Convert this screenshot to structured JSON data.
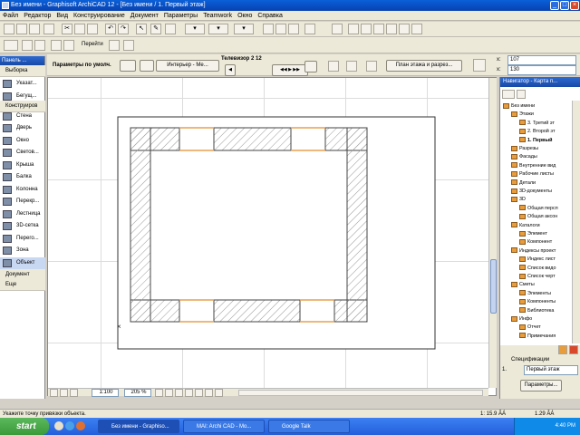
{
  "window": {
    "title": "Без имени - Graphisoft ArchiCAD 12 - [Без имени / 1. Первый этаж]"
  },
  "menu": [
    "Файл",
    "Редактор",
    "Вид",
    "Конструирование",
    "Документ",
    "Параметры",
    "Teamwork",
    "Окно",
    "Справка"
  ],
  "toolbar2": {
    "goto_label": "Перейти"
  },
  "infobox": {
    "default_params": "Параметры по умолч.",
    "interior_view": "Интерьер - Ме...",
    "object_name": "Телевизор 2 12",
    "plan_section": "План этажа и разрез...",
    "coord_x_label": "x:",
    "coord_x": "107",
    "coord_y_label": "x:",
    "coord_y": "130"
  },
  "toolbox": {
    "header": "Панель ...",
    "selection_group": "Выборка",
    "items": [
      "Указат...",
      "Бегущ...",
      "Конструиров",
      "Стена",
      "Дверь",
      "Окно",
      "Светов...",
      "Крыша",
      "Балка",
      "Колонна",
      "Перекр...",
      "Лестница",
      "3D-сетка",
      "Перего...",
      "Зона",
      "Объект",
      "Документ",
      "Еще"
    ]
  },
  "navigator": {
    "header": "Навигатор - Карта п...",
    "tree": [
      {
        "label": "Без имени",
        "level": 0
      },
      {
        "label": "Этажи",
        "level": 1
      },
      {
        "label": "3. Третий эт",
        "level": 2
      },
      {
        "label": "2. Второй эт",
        "level": 2
      },
      {
        "label": "1. Первый",
        "level": 2
      },
      {
        "label": "Разрезы",
        "level": 1
      },
      {
        "label": "Фасады",
        "level": 1
      },
      {
        "label": "Внутренние вид",
        "level": 1
      },
      {
        "label": "Рабочие листы",
        "level": 1
      },
      {
        "label": "Детали",
        "level": 1
      },
      {
        "label": "3D-документы",
        "level": 1
      },
      {
        "label": "3D",
        "level": 1
      },
      {
        "label": "Общая персп",
        "level": 2
      },
      {
        "label": "Общая аксон",
        "level": 2
      },
      {
        "label": "Каталоги",
        "level": 1
      },
      {
        "label": "Элемент",
        "level": 2
      },
      {
        "label": "Компонент",
        "level": 2
      },
      {
        "label": "Индексы проект",
        "level": 1
      },
      {
        "label": "Индекс лист",
        "level": 2
      },
      {
        "label": "Список видо",
        "level": 2
      },
      {
        "label": "Список черт",
        "level": 2
      },
      {
        "label": "Сметы",
        "level": 1
      },
      {
        "label": "Элементы",
        "level": 2
      },
      {
        "label": "Компоненты",
        "level": 2
      },
      {
        "label": "Библиотека",
        "level": 2
      },
      {
        "label": "Инфо",
        "level": 1
      },
      {
        "label": "Отчет",
        "level": 2
      },
      {
        "label": "Примечания",
        "level": 2
      }
    ]
  },
  "specs": {
    "header": "Спецификации",
    "row_num": "1.",
    "row_value": "Первый этаж",
    "params_button": "Параметры..."
  },
  "canvas_footer": {
    "scale": "1:100",
    "zoom": "205 %"
  },
  "status": {
    "hint": "Укажите точку привязки объекта.",
    "disk1": "1: 15.9 ÃÁ",
    "disk2": "1.29 ÃÁ"
  },
  "taskbar": {
    "start": "start",
    "tasks": [
      "Без имени - Graphiso...",
      "MAI: Archi CAD - Mo...",
      "Google Talk"
    ],
    "clock": "4:40 PM"
  },
  "colors": {
    "titlebar": "#0a5fd8",
    "wall_hatch": "#9a9a9a",
    "opening": "#e8a050",
    "taskbar": "#245edb"
  }
}
